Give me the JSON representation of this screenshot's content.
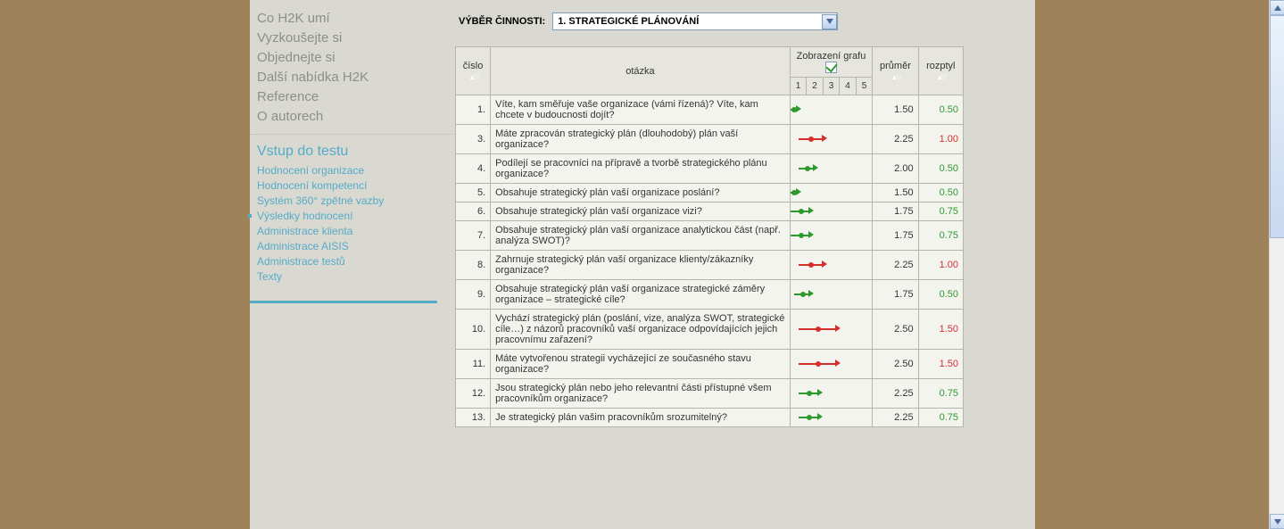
{
  "sidebar": {
    "main_nav": [
      "Co H2K umí",
      "Vyzkoušejte si",
      "Objednejte si",
      "Další nabídka H2K",
      "Reference",
      "O autorech"
    ],
    "sub_heading": "Vstup do testu",
    "sub_nav": [
      "Hodnocení organizace",
      "Hodnocení kompetencí",
      "Systém 360° zpětné vazby",
      "Výsledky hodnocení",
      "Administrace klienta",
      "Administrace AISIS",
      "Administrace testů",
      "Texty"
    ],
    "active_index": 3
  },
  "filter": {
    "label": "VÝBĚR ČINNOSTI:",
    "selected": "1. STRATEGICKÉ PLÁNOVÁNÍ"
  },
  "table": {
    "headers": {
      "num": "číslo",
      "question": "otázka",
      "chart": "Zobrazení grafu",
      "ticks": [
        "1",
        "2",
        "3",
        "4",
        "5"
      ],
      "avg": "průměr",
      "disp": "rozptyl"
    },
    "rows": [
      {
        "n": "1.",
        "q": "Víte, kam směřuje vaše organizace (vámi řízená)? Víte, kam chcete v budoucnosti dojít?",
        "avg": "1.50",
        "disp": "0.50",
        "start": 1,
        "end": 1.5,
        "color": "green"
      },
      {
        "n": "3.",
        "q": "Máte zpracován strategický plán (dlouhodobý) plán vaší organizace?",
        "avg": "2.25",
        "disp": "1.00",
        "start": 1.5,
        "end": 3.0,
        "color": "red"
      },
      {
        "n": "4.",
        "q": "Podílejí se pracovníci na přípravě a tvorbě strategického plánu organizace?",
        "avg": "2.00",
        "disp": "0.50",
        "start": 1.5,
        "end": 2.5,
        "color": "green"
      },
      {
        "n": "5.",
        "q": "Obsahuje strategický plán vaší organizace poslání?",
        "avg": "1.50",
        "disp": "0.50",
        "start": 1,
        "end": 1.5,
        "color": "green"
      },
      {
        "n": "6.",
        "q": "Obsahuje strategický plán vaší organizace vizi?",
        "avg": "1.75",
        "disp": "0.75",
        "start": 1,
        "end": 2.25,
        "color": "green"
      },
      {
        "n": "7.",
        "q": "Obsahuje strategický plán vaší organizace analytickou část (např. analýza SWOT)?",
        "avg": "1.75",
        "disp": "0.75",
        "start": 1,
        "end": 2.25,
        "color": "green"
      },
      {
        "n": "8.",
        "q": "Zahrnuje strategický plán vaší organizace klienty/zákazníky organizace?",
        "avg": "2.25",
        "disp": "1.00",
        "start": 1.5,
        "end": 3.0,
        "color": "red"
      },
      {
        "n": "9.",
        "q": "Obsahuje strategický plán vaší organizace strategické záměry organizace – strategické cíle?",
        "avg": "1.75",
        "disp": "0.50",
        "start": 1.25,
        "end": 2.25,
        "color": "green"
      },
      {
        "n": "10.",
        "q": "Vychází strategický plán (poslání, vize, analýza SWOT, strategické cíle…) z názorů pracovníků vaší organizace odpovídajících jejich pracovnímu zařazení?",
        "avg": "2.50",
        "disp": "1.50",
        "start": 1.5,
        "end": 3.8,
        "color": "red"
      },
      {
        "n": "11.",
        "q": "Máte vytvořenou strategii vycházející ze současného stavu organizace?",
        "avg": "2.50",
        "disp": "1.50",
        "start": 1.5,
        "end": 3.8,
        "color": "red"
      },
      {
        "n": "12.",
        "q": "Jsou strategický plán nebo jeho relevantní části přístupné všem pracovníkům organizace?",
        "avg": "2.25",
        "disp": "0.75",
        "start": 1.5,
        "end": 2.75,
        "color": "green"
      },
      {
        "n": "13.",
        "q": "Je strategický plán vašim pracovníkům srozumitelný?",
        "avg": "2.25",
        "disp": "0.75",
        "start": 1.5,
        "end": 2.75,
        "color": "green"
      }
    ]
  }
}
